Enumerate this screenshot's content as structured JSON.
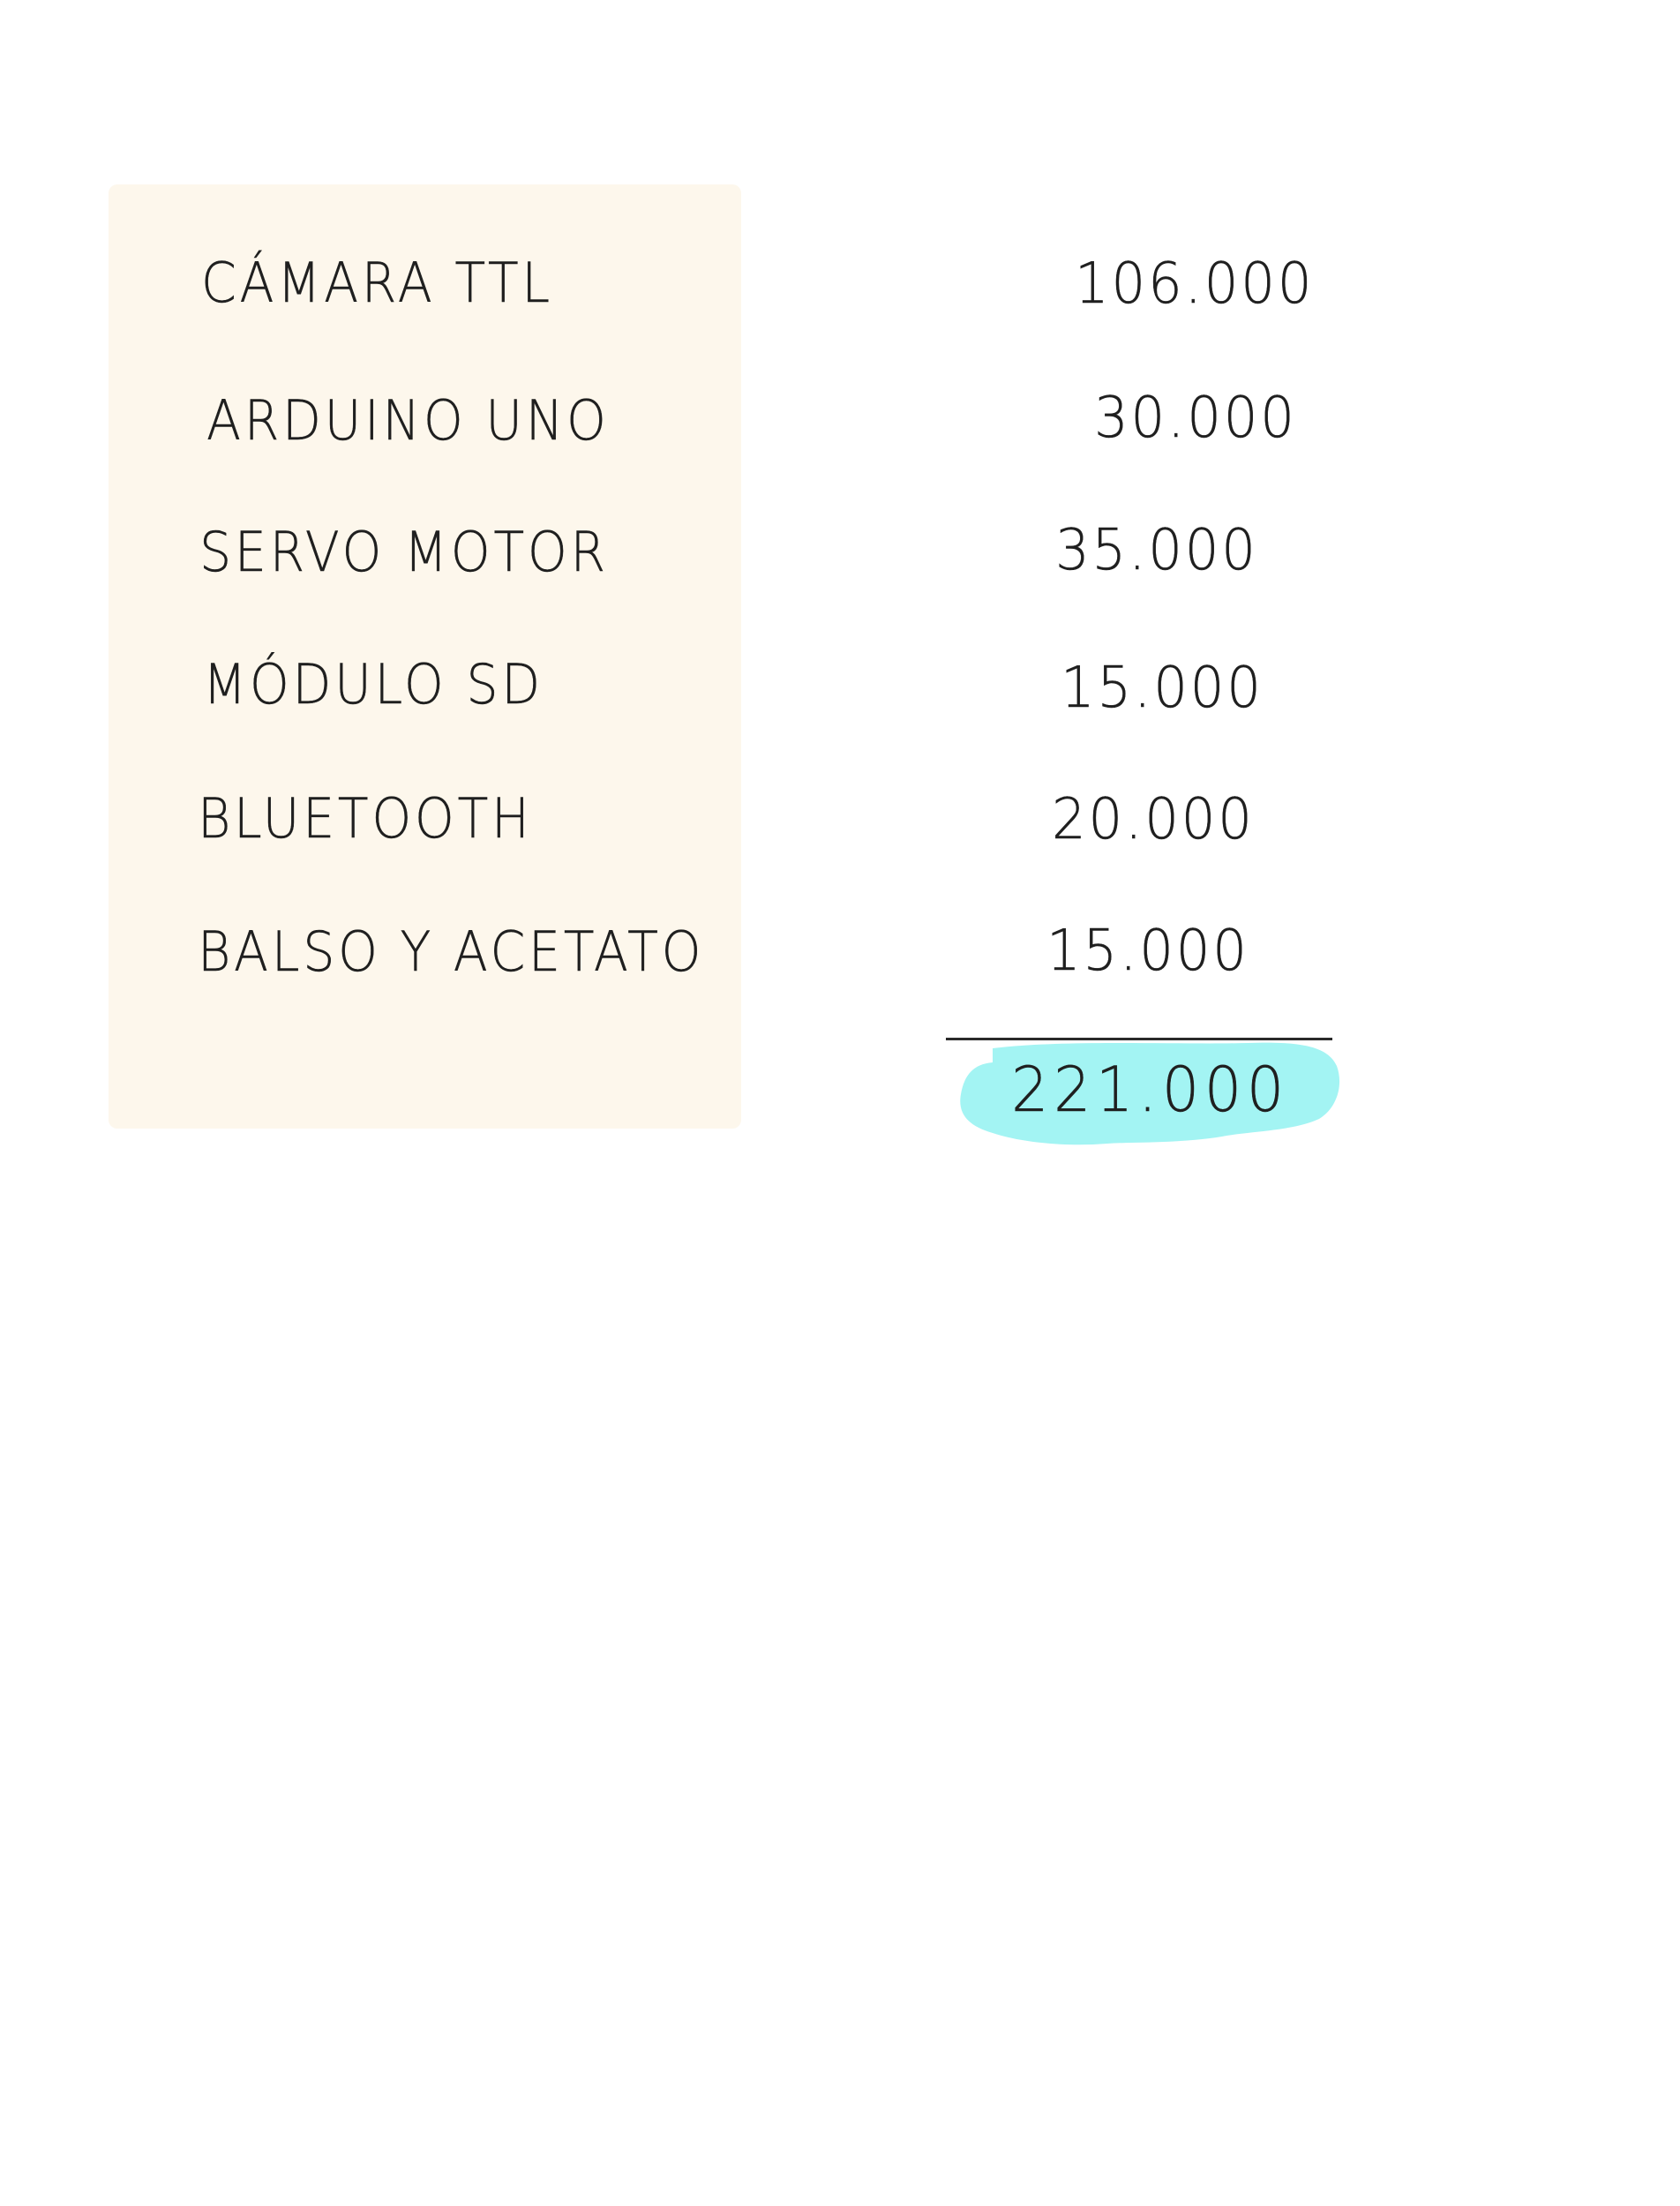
{
  "items": [
    {
      "label": "CÁMARA TTL",
      "price": "106.000"
    },
    {
      "label": "ARDUINO UNO",
      "price": "30.000"
    },
    {
      "label": "SERVO MOTOR",
      "price": "35.000"
    },
    {
      "label": "MÓDULO SD",
      "price": "15.000"
    },
    {
      "label": "BLUETOOTH",
      "price": "20.000"
    },
    {
      "label": "BALSO Y ACETATO",
      "price": "15.000"
    }
  ],
  "total": "221.000",
  "colors": {
    "card_background": "#fdf7ec",
    "highlight": "#9ef3f2",
    "ink": "#1f1f1f"
  }
}
